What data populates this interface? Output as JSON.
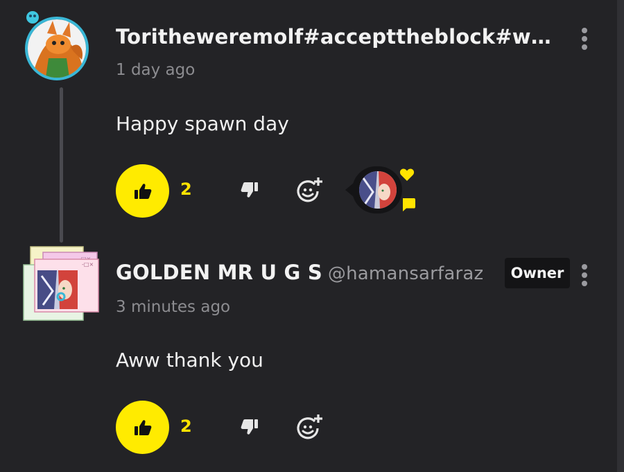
{
  "comments": [
    {
      "author": "Toritheweremolf#accepttheblock#welov...",
      "time": "1 day ago",
      "text": "Happy spawn day",
      "likes": "2",
      "hearted_by_creator": true
    },
    {
      "author": "GOLDEN MR U G S",
      "handle": "@hamansarfaraz",
      "badge": "Owner",
      "time": "3 minutes ago",
      "text": "Aww thank you",
      "likes": "2"
    }
  ],
  "colors": {
    "background": "#232326",
    "like_button": "#ffeb00",
    "like_count": "#ffe300",
    "avatar_ring": "#39b7d6"
  },
  "icons": [
    "thumbs-up-icon",
    "thumbs-down-icon",
    "add-reaction-icon",
    "more-options-icon",
    "heart-icon",
    "chat-bubble-icon"
  ]
}
